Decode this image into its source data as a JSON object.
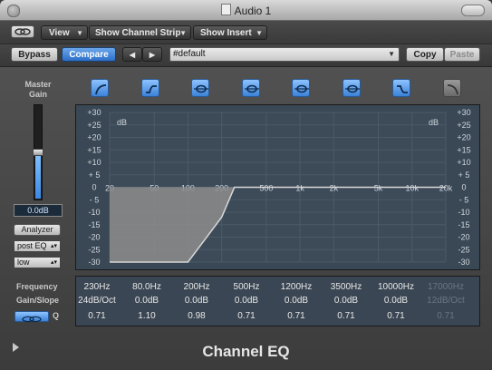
{
  "window": {
    "title": "Audio 1"
  },
  "toolbar": {
    "view_label": "View",
    "channel_strip_label": "Show Channel Strip",
    "insert_label": "Show Insert",
    "bypass_label": "Bypass",
    "compare_label": "Compare",
    "prev_label": "◀",
    "next_label": "▶",
    "preset_value": "#default",
    "copy_label": "Copy",
    "paste_label": "Paste"
  },
  "band_icons": [
    "low-cut-icon",
    "low-shelf-icon",
    "bell-icon",
    "bell-icon",
    "bell-icon",
    "bell-icon",
    "high-shelf-icon",
    "high-cut-icon"
  ],
  "master": {
    "label_line1": "Master",
    "label_line2": "Gain",
    "value": "0.0dB",
    "level_fraction": 0.5
  },
  "analyzer": {
    "label": "Analyzer",
    "mode": "post EQ",
    "resolution": "low"
  },
  "graph": {
    "unit_left": "dB",
    "unit_right": "dB",
    "db_ticks": [
      "+30",
      "+25",
      "+20",
      "+15",
      "+10",
      "+ 5",
      "0",
      "- 5",
      "-10",
      "-15",
      "-20",
      "-25",
      "-30"
    ],
    "freq_ticks": [
      "20",
      "50",
      "100",
      "200",
      "500",
      "1k",
      "2k",
      "5k",
      "10k",
      "20k"
    ]
  },
  "chart_data": {
    "type": "line",
    "x": [
      20,
      100,
      200,
      260,
      20000
    ],
    "y": [
      -30,
      -30,
      -12,
      0,
      0
    ],
    "xlim": [
      20,
      20000
    ],
    "ylim": [
      -30,
      30
    ],
    "xscale": "log"
  },
  "params": {
    "frequency_label": "Frequency",
    "gain_slope_label": "Gain/Slope",
    "q_label": "Q",
    "bands": [
      {
        "freq": "230Hz",
        "gain": "24dB/Oct",
        "q": "0.71",
        "active": true
      },
      {
        "freq": "80.0Hz",
        "gain": "0.0dB",
        "q": "1.10",
        "active": true
      },
      {
        "freq": "200Hz",
        "gain": "0.0dB",
        "q": "0.98",
        "active": true
      },
      {
        "freq": "500Hz",
        "gain": "0.0dB",
        "q": "0.71",
        "active": true
      },
      {
        "freq": "1200Hz",
        "gain": "0.0dB",
        "q": "0.71",
        "active": true
      },
      {
        "freq": "3500Hz",
        "gain": "0.0dB",
        "q": "0.71",
        "active": true
      },
      {
        "freq": "10000Hz",
        "gain": "0.0dB",
        "q": "0.71",
        "active": true
      },
      {
        "freq": "17000Hz",
        "gain": "12dB/Oct",
        "q": "0.71",
        "active": false
      }
    ]
  },
  "footer": {
    "plugin_name": "Channel EQ"
  },
  "colors": {
    "accent": "#3b82d8",
    "graph_bg": "#3a4855",
    "curve_fill": "#8c8c8c"
  }
}
